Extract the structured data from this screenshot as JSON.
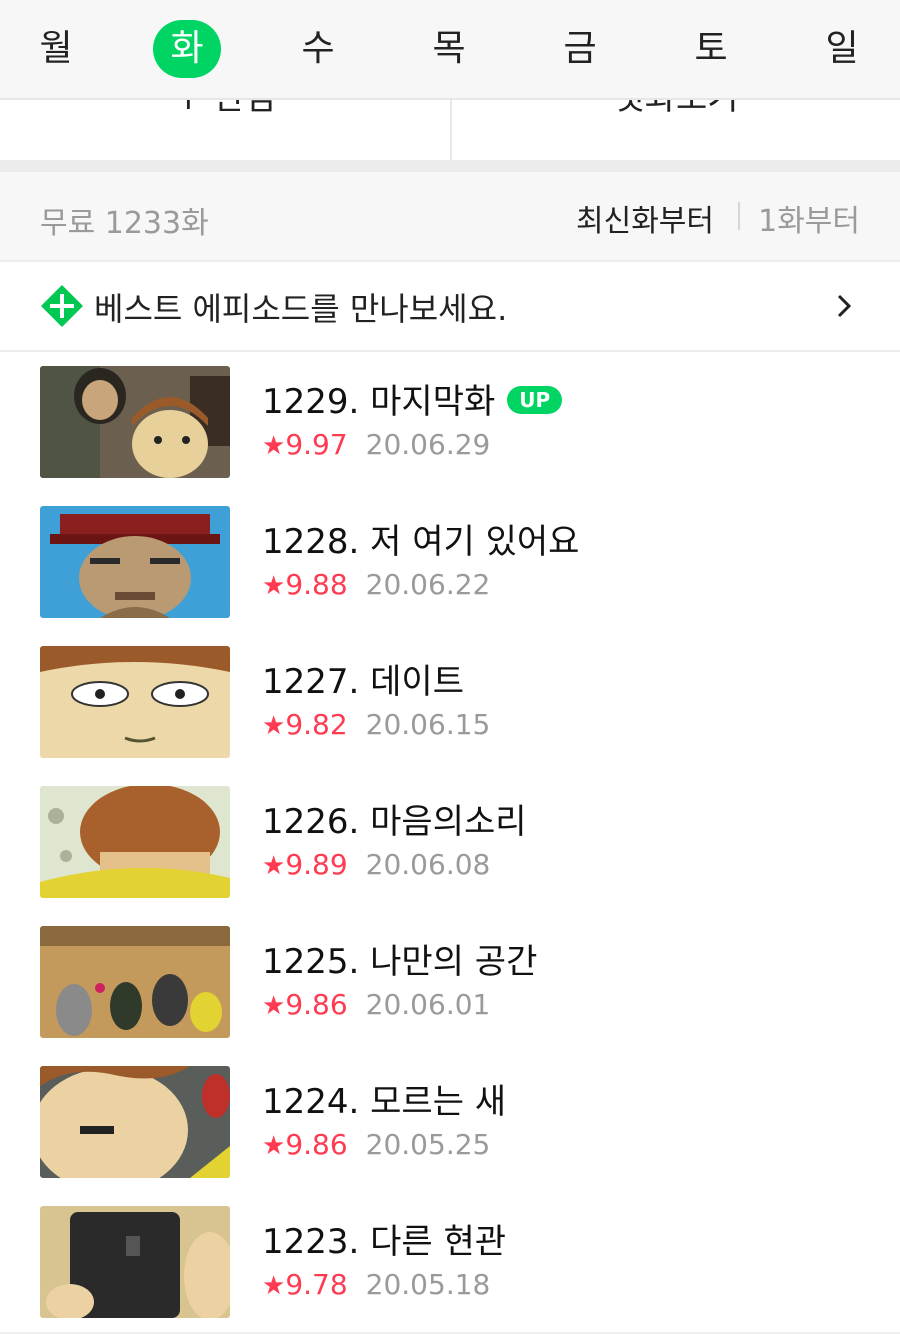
{
  "days": [
    {
      "label": "월",
      "active": false
    },
    {
      "label": "화",
      "active": true
    },
    {
      "label": "수",
      "active": false
    },
    {
      "label": "목",
      "active": false
    },
    {
      "label": "금",
      "active": false
    },
    {
      "label": "토",
      "active": false
    },
    {
      "label": "일",
      "active": false
    }
  ],
  "actions": {
    "left_label": "+ 관심",
    "right_label": "첫화보기"
  },
  "list_header": {
    "count_label": "무료 1233화",
    "sort_newest": "최신화부터",
    "sort_oldest": "1화부터"
  },
  "best_banner": {
    "text": "베스트 에피소드를 만나보세요.",
    "icon": "plus-diamond-icon",
    "chevron": "chevron-right-icon"
  },
  "episodes": [
    {
      "title": "1229. 마지막화",
      "badge": "UP",
      "rating": "9.97",
      "date": "20.06.29"
    },
    {
      "title": "1228. 저 여기 있어요",
      "badge": "",
      "rating": "9.88",
      "date": "20.06.22"
    },
    {
      "title": "1227. 데이트",
      "badge": "",
      "rating": "9.82",
      "date": "20.06.15"
    },
    {
      "title": "1226. 마음의소리",
      "badge": "",
      "rating": "9.89",
      "date": "20.06.08"
    },
    {
      "title": "1225. 나만의 공간",
      "badge": "",
      "rating": "9.86",
      "date": "20.06.01"
    },
    {
      "title": "1224. 모르는 새",
      "badge": "",
      "rating": "9.86",
      "date": "20.05.25"
    },
    {
      "title": "1223. 다른 현관",
      "badge": "",
      "rating": "9.78",
      "date": "20.05.18"
    }
  ],
  "colors": {
    "accent": "#00d564",
    "rating": "#ff3b52",
    "muted": "#9a9a9a"
  }
}
